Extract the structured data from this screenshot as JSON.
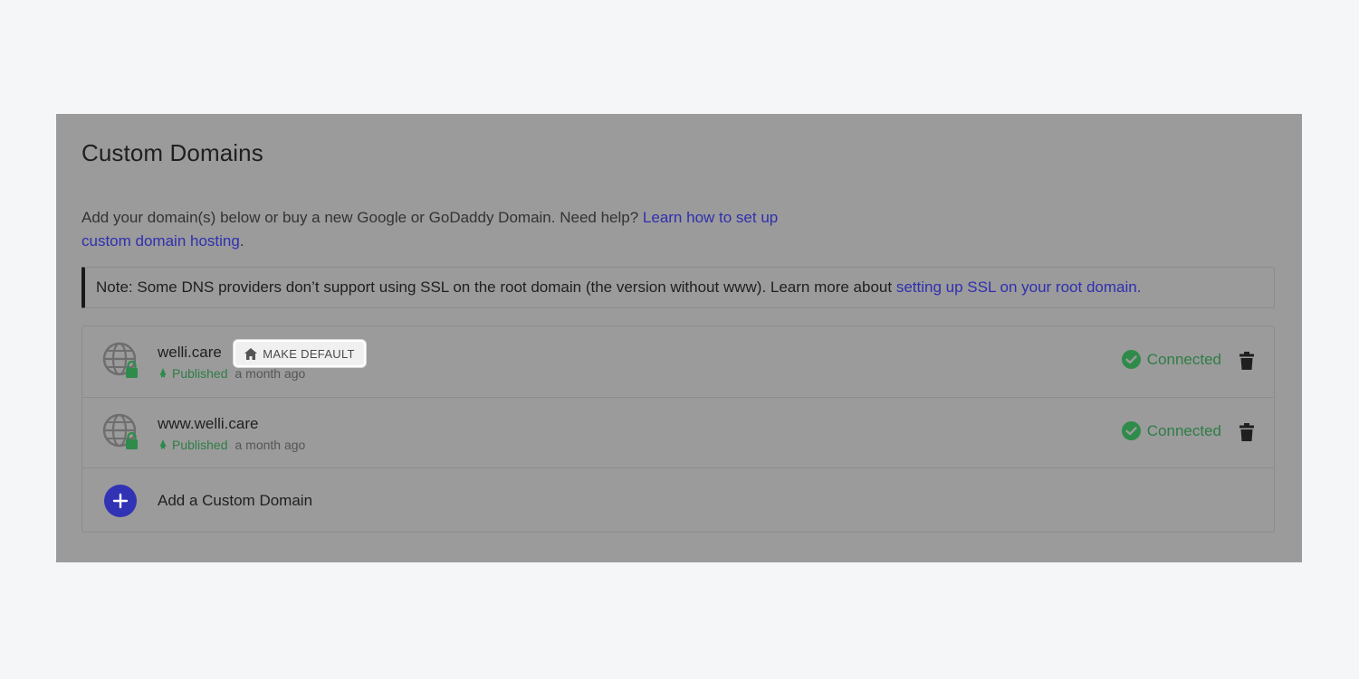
{
  "page": {
    "title": "Custom Domains"
  },
  "intro": {
    "text": "Add your domain(s) below or buy a new Google or GoDaddy Domain. Need help? ",
    "link_text": "Learn how to set up custom domain hosting",
    "suffix": "."
  },
  "note": {
    "text": "Note: Some DNS providers don’t support using SSL on the root domain (the version without www). Learn more about ",
    "link_text": "setting up SSL on your root domain."
  },
  "domains": [
    {
      "name": "welli.care",
      "make_default_label": "MAKE DEFAULT",
      "published_label": "Published",
      "published_ago": "a month ago",
      "status": "Connected"
    },
    {
      "name": "www.welli.care",
      "published_label": "Published",
      "published_ago": "a month ago",
      "status": "Connected"
    }
  ],
  "add_domain": {
    "label": "Add a Custom Domain"
  },
  "colors": {
    "accent": "#3232b5",
    "success": "#2e7d46",
    "overlay": "#9b9b9b"
  },
  "icons": {
    "domain": "globe-lock-icon",
    "published": "rocket-icon",
    "make_default": "home-icon",
    "status": "check-circle-icon",
    "delete": "trash-icon",
    "add": "plus-icon"
  }
}
